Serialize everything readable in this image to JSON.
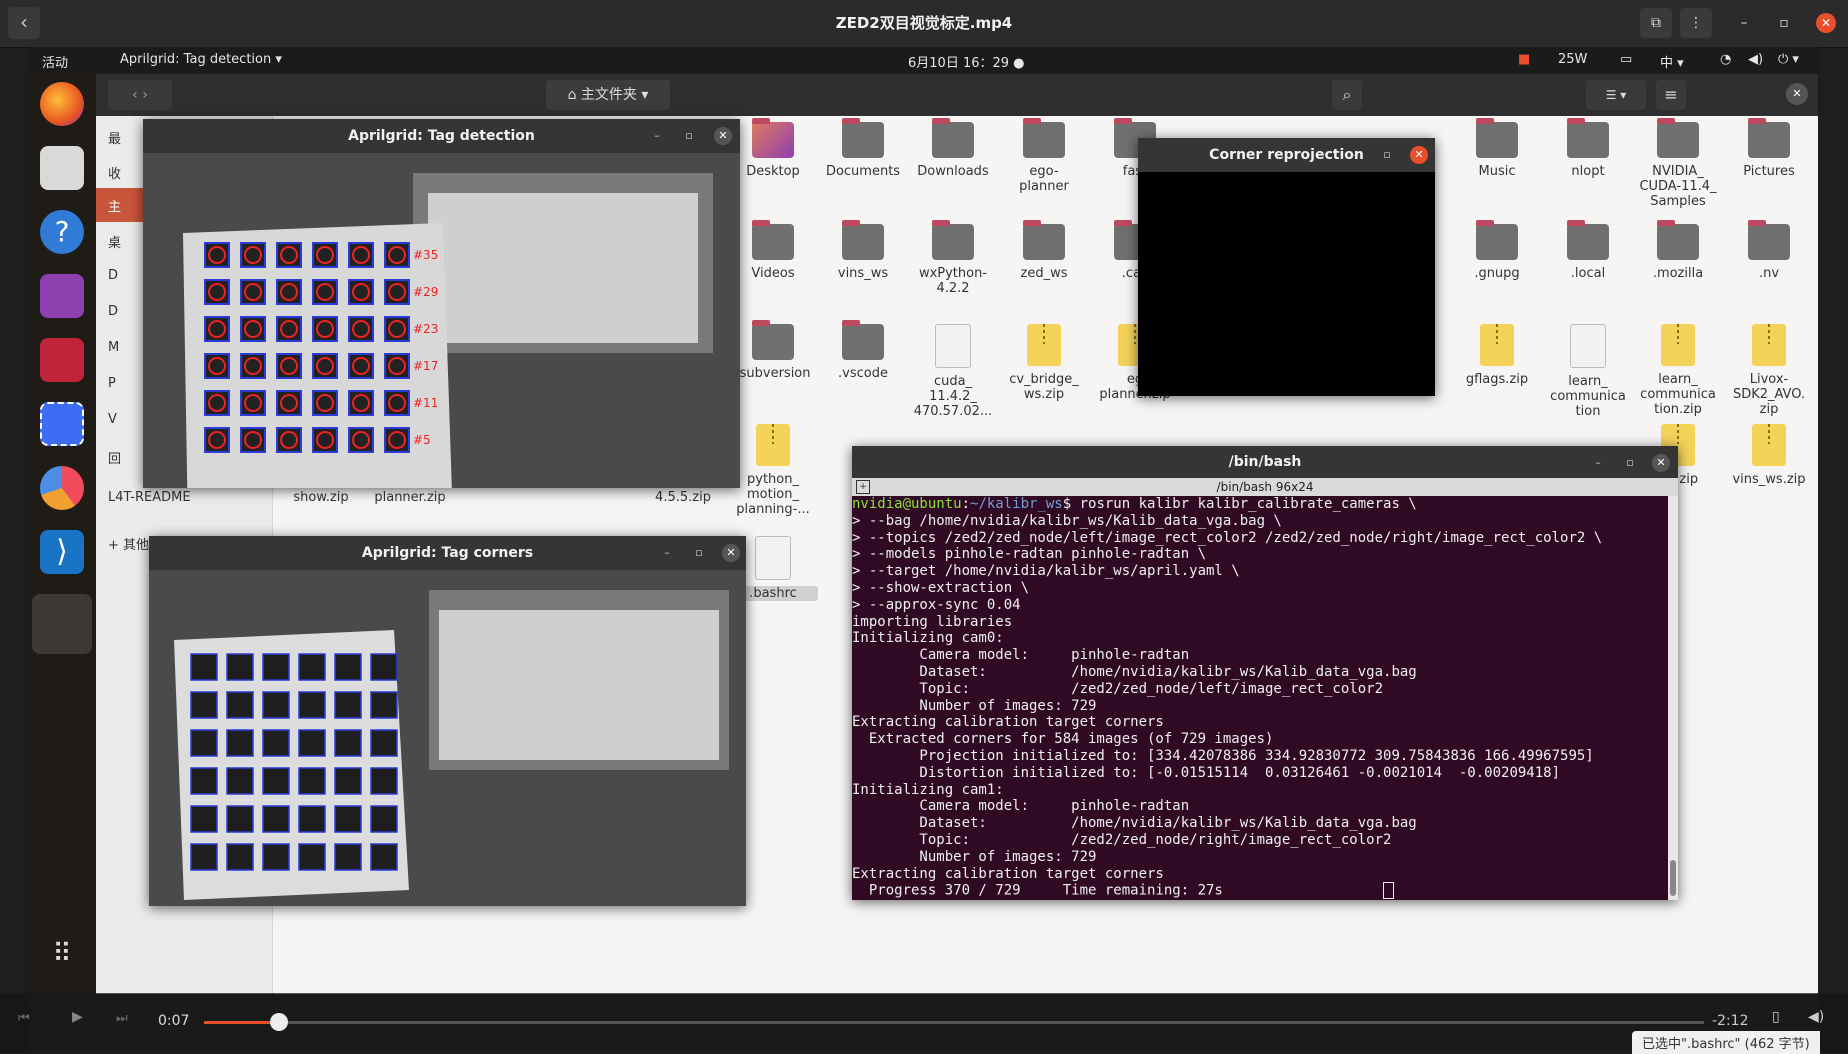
{
  "player": {
    "title": "ZED2双目视觉标定.mp4",
    "back_icon": "‹",
    "time_elapsed": "0:07",
    "time_remaining": "-2:12",
    "progress": 0.05,
    "status_text": "已选中\".bashrc\" (462 字节)",
    "accent": "#e94f2a"
  },
  "topbar": {
    "activities": "活动",
    "app_menu": "Aprilgrid: Tag detection ▾",
    "clock": "6月10日  16：29  ●",
    "power": "25W",
    "input_method": "中 ▾"
  },
  "nautilus": {
    "location": "主文件夹",
    "sidebar": [
      "最",
      "收",
      "主",
      "桌",
      "D",
      "D",
      "M",
      "P",
      "V",
      "回",
      "L4T-README",
      "+ 其他"
    ],
    "files": [
      {
        "name": "Desktop",
        "kind": "desktop"
      },
      {
        "name": "Documents",
        "kind": "folder"
      },
      {
        "name": "Downloads",
        "kind": "folder"
      },
      {
        "name": "ego-\nplanner",
        "kind": "folder"
      },
      {
        "name": "fast",
        "kind": "folder"
      },
      {
        "name": "Music",
        "kind": "folder"
      },
      {
        "name": "nlopt",
        "kind": "folder"
      },
      {
        "name": "NVIDIA_\nCUDA-11.4_\nSamples",
        "kind": "folder"
      },
      {
        "name": "Pictures",
        "kind": "folder"
      },
      {
        "name": "Videos",
        "kind": "folder"
      },
      {
        "name": "vins_ws",
        "kind": "folder"
      },
      {
        "name": "wxPython-\n4.2.2",
        "kind": "folder"
      },
      {
        "name": "zed_ws",
        "kind": "folder"
      },
      {
        "name": ".cac",
        "kind": "folder"
      },
      {
        "name": ".gnupg",
        "kind": "folder"
      },
      {
        "name": ".local",
        "kind": "folder"
      },
      {
        "name": ".mozilla",
        "kind": "folder"
      },
      {
        "name": ".nv",
        "kind": "folder"
      },
      {
        "name": ".subversion",
        "kind": "folder"
      },
      {
        "name": ".vscode",
        "kind": "folder"
      },
      {
        "name": "cuda_\n11.4.2_\n470.57.02...",
        "kind": "doc"
      },
      {
        "name": "cv_bridge_\nws.zip",
        "kind": "zip"
      },
      {
        "name": "eg\nplanner.zip",
        "kind": "zip"
      },
      {
        "name": "gflags.zip",
        "kind": "zip"
      },
      {
        "name": "learn_\ncommunica\ntion",
        "kind": "doc"
      },
      {
        "name": "learn_\ncommunica\ntion.zip",
        "kind": "zip"
      },
      {
        "name": "Livox-\nSDK2_AVO.\nzip",
        "kind": "zip"
      },
      {
        "name": "python_\nmotion_\nplanning-...",
        "kind": "zip"
      },
      {
        "name": "ws.zip",
        "kind": "zip"
      },
      {
        "name": "vins_ws.zip",
        "kind": "zip"
      },
      {
        "name": "show.zip",
        "kind": "none"
      },
      {
        "name": "planner.zip",
        "kind": "none"
      },
      {
        "name": "4.5.5.zip",
        "kind": "none"
      },
      {
        "name": ".bashrc",
        "kind": "doc"
      }
    ]
  },
  "windows": {
    "tag_detection": {
      "title": "Aprilgrid: Tag detection",
      "tag_ids": [
        "#35",
        "#29",
        "#23",
        "#17",
        "#11",
        "#5"
      ]
    },
    "tag_corners": {
      "title": "Aprilgrid: Tag corners"
    },
    "corner_reprojection": {
      "title": "Corner reprojection"
    },
    "terminal": {
      "title": "/bin/bash",
      "subtitle": "/bin/bash 96x24",
      "lines": [
        "nvidia@ubuntu:~/kalibr_ws$ rosrun kalibr kalibr_calibrate_cameras \\",
        "> --bag /home/nvidia/kalibr_ws/Kalib_data_vga.bag \\",
        "> --topics /zed2/zed_node/left/image_rect_color2 /zed2/zed_node/right/image_rect_color2 \\",
        "> --models pinhole-radtan pinhole-radtan \\",
        "> --target /home/nvidia/kalibr_ws/april.yaml \\",
        "> --show-extraction \\",
        "> --approx-sync 0.04",
        "importing libraries",
        "Initializing cam0:",
        "        Camera model:     pinhole-radtan",
        "        Dataset:          /home/nvidia/kalibr_ws/Kalib_data_vga.bag",
        "        Topic:            /zed2/zed_node/left/image_rect_color2",
        "        Number of images: 729",
        "Extracting calibration target corners",
        "  Extracted corners for 584 images (of 729 images)",
        "        Projection initialized to: [334.42078386 334.92830772 309.75843836 166.49967595]",
        "        Distortion initialized to: [-0.01515114  0.03126461 -0.0021014  -0.00209418]",
        "Initializing cam1:",
        "        Camera model:     pinhole-radtan",
        "        Dataset:          /home/nvidia/kalibr_ws/Kalib_data_vga.bag",
        "        Topic:            /zed2/zed_node/right/image_rect_color2",
        "        Number of images: 729",
        "Extracting calibration target corners",
        "  Progress 370 / 729     Time remaining: 27s"
      ],
      "bg": "#300a24",
      "prompt_user": "#8ae234",
      "prompt_path": "#729fcf"
    }
  }
}
